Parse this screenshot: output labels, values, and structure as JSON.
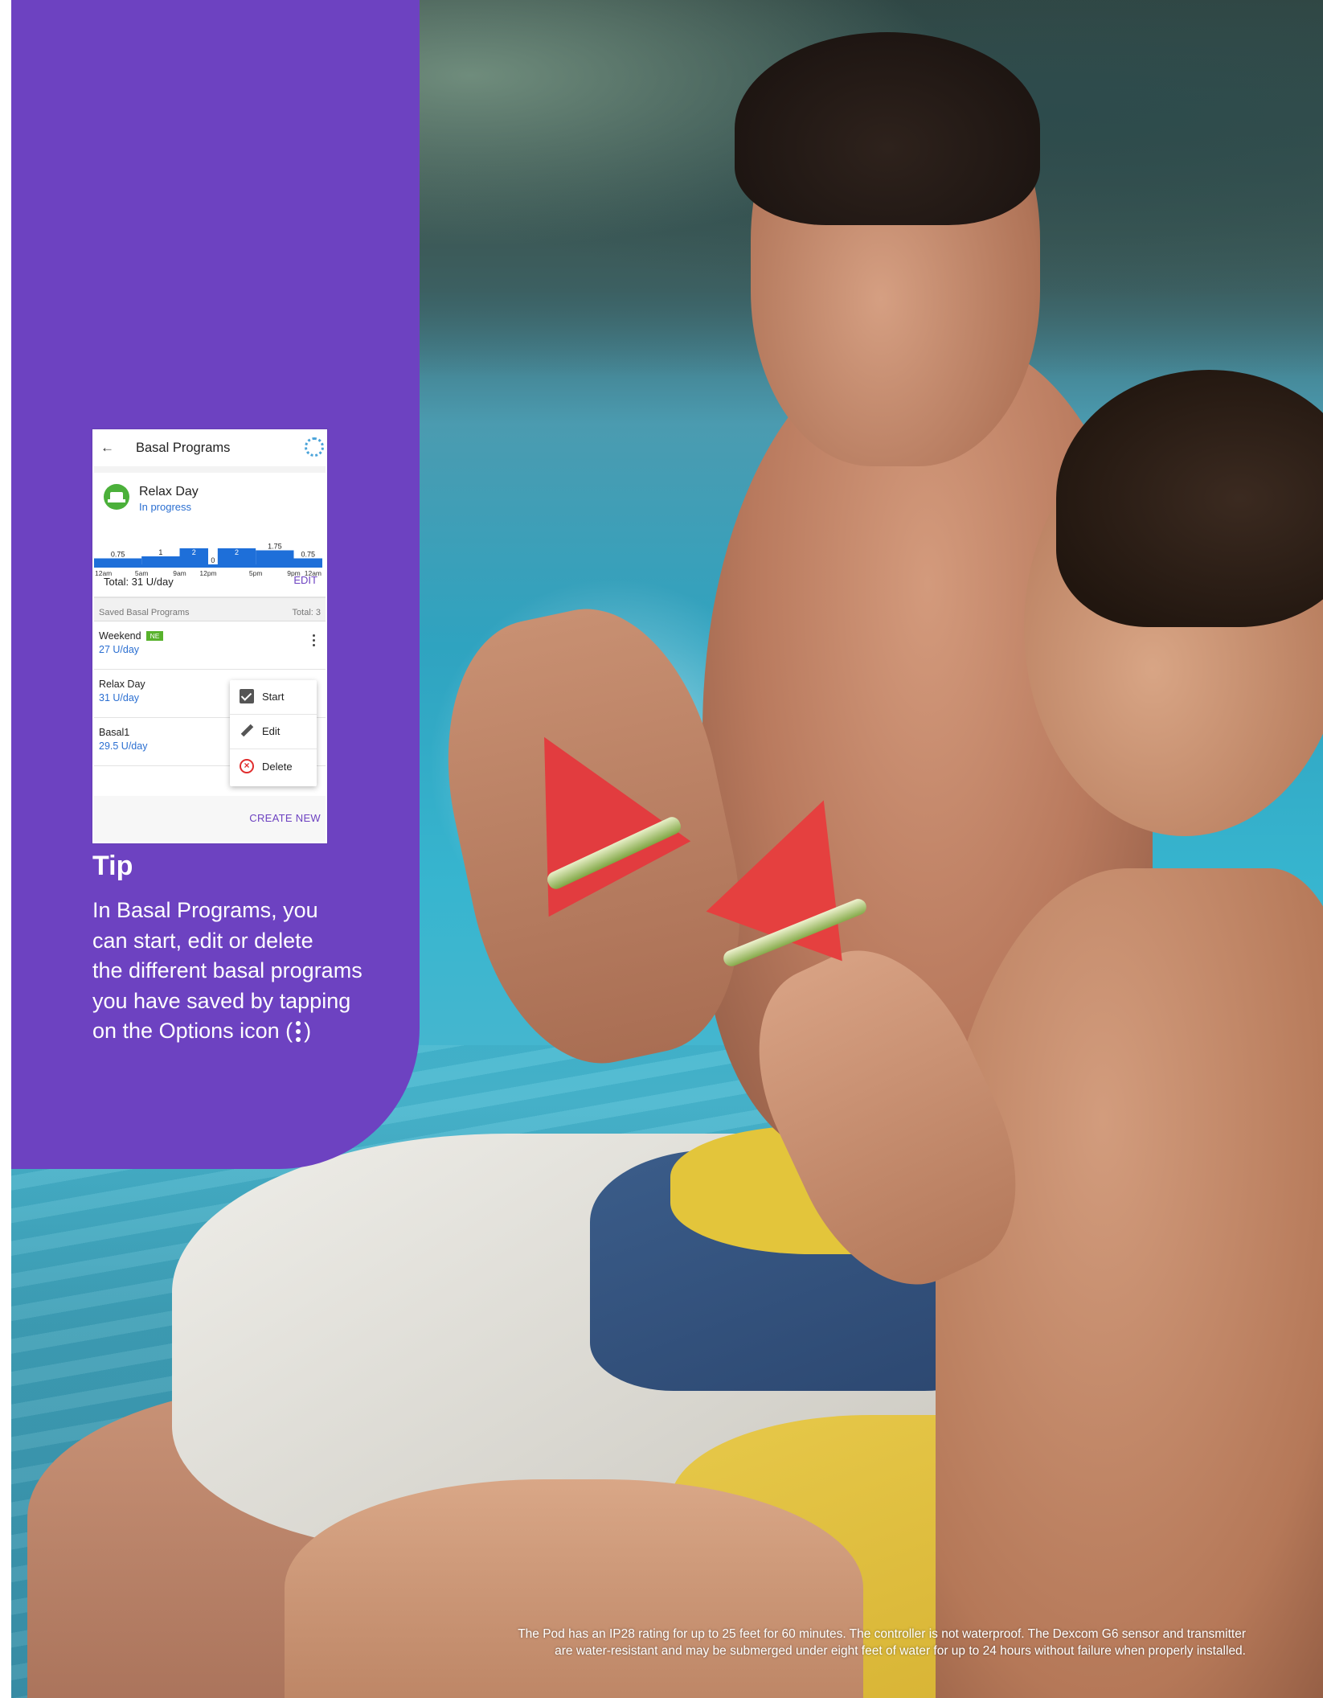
{
  "phone": {
    "header_title": "Basal Programs",
    "back_icon": "arrow-left-icon",
    "spinner_icon": "loading-spinner-icon",
    "active_program": {
      "name": "Relax Day",
      "status": "In progress",
      "icon": "basal-program-icon",
      "total": "Total: 31 U/day",
      "edit_label": "EDIT"
    },
    "saved_header": {
      "label": "Saved Basal Programs",
      "total": "Total: 3"
    },
    "programs": [
      {
        "name": "Weekend",
        "badge": "NE",
        "total": "27 U/day"
      },
      {
        "name": "Relax Day",
        "total": "31 U/day"
      },
      {
        "name": "Basal1",
        "total": "29.5 U/day"
      }
    ],
    "menu": [
      {
        "label": "Start",
        "icon": "checkbox-icon"
      },
      {
        "label": "Edit",
        "icon": "pencil-icon"
      },
      {
        "label": "Delete",
        "icon": "delete-circle-icon"
      }
    ],
    "create_new_label": "CREATE NEW"
  },
  "chart_data": {
    "type": "bar",
    "x_ticks": [
      "12am",
      "5am",
      "9am",
      "12pm",
      "5pm",
      "9pm",
      "12am"
    ],
    "segments": [
      {
        "start_hour": 0,
        "end_hour": 5,
        "value": 0.75,
        "label": "0.75"
      },
      {
        "start_hour": 5,
        "end_hour": 9,
        "value": 1,
        "label": "1"
      },
      {
        "start_hour": 9,
        "end_hour": 12,
        "value": 2,
        "label": "2"
      },
      {
        "start_hour": 12,
        "end_hour": 13,
        "value": 0,
        "label": "0"
      },
      {
        "start_hour": 13,
        "end_hour": 17,
        "value": 2,
        "label": "2"
      },
      {
        "start_hour": 17,
        "end_hour": 21,
        "value": 1.75,
        "label": "1.75"
      },
      {
        "start_hour": 21,
        "end_hour": 24,
        "value": 0.75,
        "label": "0.75"
      }
    ],
    "ylim": [
      0,
      2
    ],
    "colors": {
      "bar": "#1e6fd9",
      "label_on_bar": "#ffffff",
      "label": "#222222"
    }
  },
  "tip": {
    "title": "Tip",
    "lines": [
      "In Basal Programs, you",
      "can start, edit or delete",
      "the different basal programs",
      "you have saved by tapping"
    ],
    "last_line_prefix": "on the Options icon (",
    "last_line_suffix": ")",
    "options_icon": "kebab-menu-icon"
  },
  "disclaimer": {
    "line1": "The Pod has an IP28 rating for up to 25 feet for 60 minutes. The controller is not waterproof. The Dexcom G6 sensor and transmitter",
    "line2": "are water-resistant and may be submerged under eight feet of water for up to 24 hours without failure when properly installed."
  },
  "colors": {
    "panel": "#6d42c1",
    "accent_link": "#2b6fd1",
    "badge": "#58b22c",
    "delete": "#e02d2d"
  }
}
